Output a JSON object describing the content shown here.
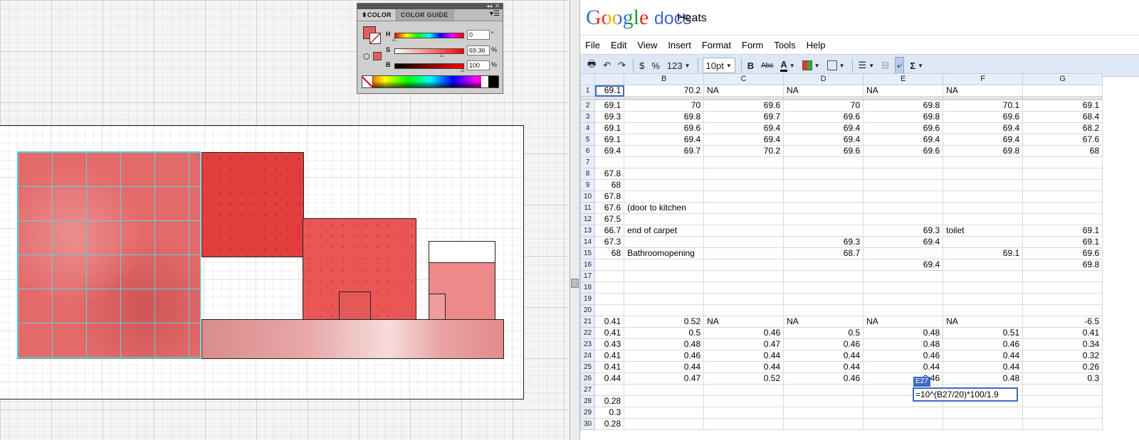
{
  "color_panel": {
    "tabs": [
      "COLOR",
      "COLOR GUIDE"
    ],
    "h": {
      "label": "H",
      "value": "0",
      "unit": "°",
      "fraction": 0.0
    },
    "s": {
      "label": "S",
      "value": "69.36",
      "unit": "%",
      "fraction": 0.6936
    },
    "b": {
      "label": "B",
      "value": "100",
      "unit": "%",
      "fraction": 1.0
    },
    "fill_color": "#e65c5c"
  },
  "docs": {
    "logo_google": "Google",
    "logo_docs": "docs",
    "title": "Heats",
    "menu": [
      "File",
      "Edit",
      "View",
      "Insert",
      "Format",
      "Form",
      "Tools",
      "Help"
    ],
    "toolbar": {
      "currency": "$",
      "percent": "%",
      "number_format": "123",
      "font_size": "10pt",
      "bold": "B",
      "strike": "Abc",
      "text_color": "A",
      "sum": "Σ"
    },
    "columns": [
      "",
      "B",
      "C",
      "D",
      "E",
      "F",
      "G"
    ],
    "rows": [
      {
        "n": "1",
        "cells": [
          "69.1",
          "70.2",
          "NA",
          "NA",
          "NA",
          "NA",
          ""
        ]
      },
      {
        "n": "2",
        "cells": [
          "69.1",
          "70",
          "69.6",
          "70",
          "69.8",
          "70.1",
          "69.1"
        ]
      },
      {
        "n": "3",
        "cells": [
          "69.3",
          "69.8",
          "69.7",
          "69.6",
          "69.8",
          "69.6",
          "68.4"
        ]
      },
      {
        "n": "4",
        "cells": [
          "69.1",
          "69.6",
          "69.4",
          "69.4",
          "69.6",
          "69.4",
          "68.2"
        ]
      },
      {
        "n": "5",
        "cells": [
          "69.1",
          "69.4",
          "69.4",
          "69.4",
          "69.4",
          "69.4",
          "67.6"
        ]
      },
      {
        "n": "6",
        "cells": [
          "69.4",
          "69.7",
          "70.2",
          "69.6",
          "69.6",
          "69.8",
          "68"
        ]
      },
      {
        "n": "7",
        "cells": [
          "",
          "",
          "",
          "",
          "",
          "",
          ""
        ]
      },
      {
        "n": "8",
        "cells": [
          "67.8",
          "",
          "",
          "",
          "",
          "",
          ""
        ]
      },
      {
        "n": "9",
        "cells": [
          "68",
          "",
          "",
          "",
          "",
          "",
          ""
        ]
      },
      {
        "n": "10",
        "cells": [
          "67.8",
          "",
          "",
          "",
          "",
          "",
          ""
        ]
      },
      {
        "n": "11",
        "cells": [
          "67.6",
          "(door to kitchen",
          "",
          "",
          "",
          "",
          ""
        ]
      },
      {
        "n": "12",
        "cells": [
          "67.5",
          "",
          "",
          "",
          "",
          "",
          ""
        ]
      },
      {
        "n": "13",
        "cells": [
          "66.7",
          "end of carpet",
          "",
          "",
          "69.3",
          "toilet",
          "69.1"
        ]
      },
      {
        "n": "14",
        "cells": [
          "67.3",
          "",
          "",
          "69.3",
          "69.4",
          "",
          "69.1"
        ]
      },
      {
        "n": "15",
        "cells": [
          "68",
          "Bathroomopening",
          "",
          "68.7",
          "",
          "69.1",
          "69.6"
        ]
      },
      {
        "n": "16",
        "cells": [
          "",
          "",
          "",
          "",
          "69.4",
          "",
          "69.8"
        ]
      },
      {
        "n": "17",
        "cells": [
          "",
          "",
          "",
          "",
          "",
          "",
          ""
        ]
      },
      {
        "n": "18",
        "cells": [
          "",
          "",
          "",
          "",
          "",
          "",
          ""
        ]
      },
      {
        "n": "19",
        "cells": [
          "",
          "",
          "",
          "",
          "",
          "",
          ""
        ]
      },
      {
        "n": "20",
        "cells": [
          "",
          "",
          "",
          "",
          "",
          "",
          ""
        ]
      },
      {
        "n": "21",
        "cells": [
          "0.41",
          "0.52",
          "NA",
          "NA",
          "NA",
          "NA",
          "-6.5"
        ]
      },
      {
        "n": "22",
        "cells": [
          "0.41",
          "0.5",
          "0.46",
          "0.5",
          "0.48",
          "0.51",
          "0.41"
        ]
      },
      {
        "n": "23",
        "cells": [
          "0.43",
          "0.48",
          "0.47",
          "0.46",
          "0.48",
          "0.46",
          "0.34"
        ]
      },
      {
        "n": "24",
        "cells": [
          "0.41",
          "0.46",
          "0.44",
          "0.44",
          "0.46",
          "0.44",
          "0.32"
        ]
      },
      {
        "n": "25",
        "cells": [
          "0.41",
          "0.44",
          "0.44",
          "0.44",
          "0.44",
          "0.44",
          "0.26"
        ]
      },
      {
        "n": "26",
        "cells": [
          "0.44",
          "0.47",
          "0.52",
          "0.46",
          "0.46",
          "0.48",
          "0.3"
        ]
      },
      {
        "n": "27",
        "cells": [
          "",
          "",
          "",
          "",
          "",
          "",
          ""
        ]
      },
      {
        "n": "28",
        "cells": [
          "0.28",
          "",
          "",
          "",
          "",
          "",
          ""
        ]
      },
      {
        "n": "29",
        "cells": [
          "0.3",
          "",
          "",
          "",
          "",
          "",
          ""
        ]
      },
      {
        "n": "30",
        "cells": [
          "0.28",
          "",
          "",
          "",
          "",
          "",
          ""
        ]
      }
    ],
    "active_cell": "E27",
    "editor_formula": "=10^(B27/20)*100/1.9"
  }
}
